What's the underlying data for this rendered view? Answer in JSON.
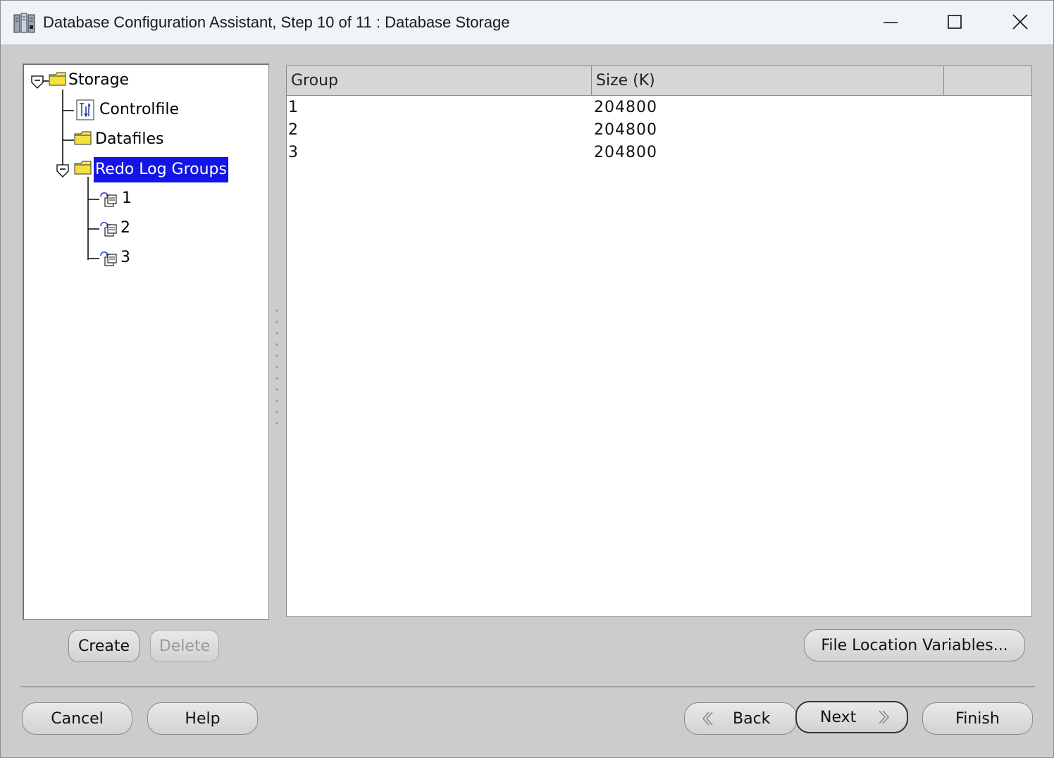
{
  "window": {
    "title": "Database Configuration Assistant, Step 10 of 11 : Database Storage",
    "controls": {
      "minimize_icon": "minimize-icon",
      "maximize_icon": "maximize-icon",
      "close_icon": "close-icon"
    }
  },
  "tree": {
    "root": {
      "label": "Storage",
      "icon": "folder-icon",
      "expanded": true
    },
    "items": [
      {
        "label": "Controlfile",
        "icon": "controlfile-icon"
      },
      {
        "label": "Datafiles",
        "icon": "folder-icon"
      },
      {
        "label": "Redo Log Groups",
        "icon": "folder-icon",
        "expanded": true,
        "selected": true,
        "children": [
          {
            "label": "1",
            "icon": "redo-log-icon"
          },
          {
            "label": "2",
            "icon": "redo-log-icon"
          },
          {
            "label": "3",
            "icon": "redo-log-icon"
          }
        ]
      }
    ]
  },
  "table": {
    "columns": [
      "Group",
      "Size (K)"
    ],
    "rows": [
      [
        "1",
        "204800"
      ],
      [
        "2",
        "204800"
      ],
      [
        "3",
        "204800"
      ]
    ]
  },
  "buttons": {
    "create": "Create",
    "delete": "Delete",
    "file_location_variables": "File Location Variables...",
    "cancel": "Cancel",
    "help": "Help",
    "back": "Back",
    "next": "Next",
    "finish": "Finish"
  },
  "colors": {
    "selection": "#1414e6",
    "dialog_bg": "#cccccc",
    "titlebar_bg": "#f0f3f8"
  }
}
